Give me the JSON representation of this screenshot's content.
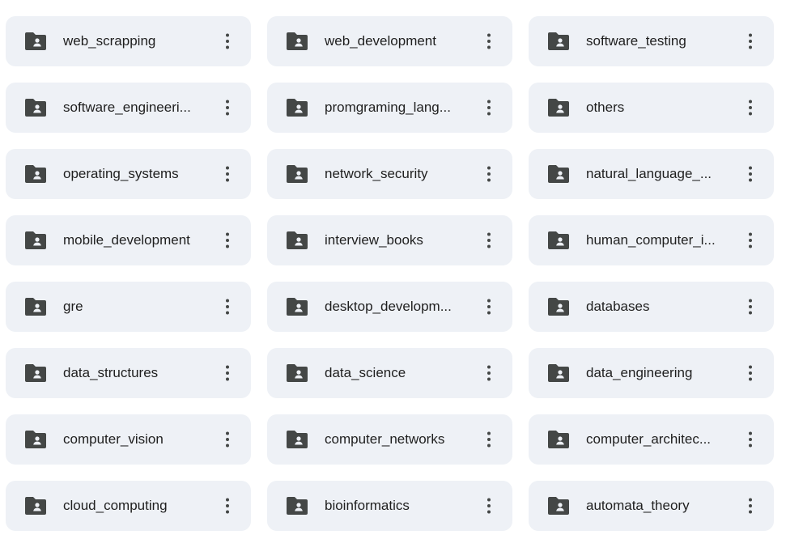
{
  "folders": [
    {
      "name": "web_scrapping"
    },
    {
      "name": "web_development"
    },
    {
      "name": "software_testing"
    },
    {
      "name": "software_engineeri..."
    },
    {
      "name": "promgraming_lang..."
    },
    {
      "name": "others"
    },
    {
      "name": "operating_systems"
    },
    {
      "name": "network_security"
    },
    {
      "name": "natural_language_..."
    },
    {
      "name": "mobile_development"
    },
    {
      "name": "interview_books"
    },
    {
      "name": "human_computer_i..."
    },
    {
      "name": "gre"
    },
    {
      "name": "desktop_developm..."
    },
    {
      "name": "databases"
    },
    {
      "name": "data_structures"
    },
    {
      "name": "data_science"
    },
    {
      "name": "data_engineering"
    },
    {
      "name": "computer_vision"
    },
    {
      "name": "computer_networks"
    },
    {
      "name": "computer_architec..."
    },
    {
      "name": "cloud_computing"
    },
    {
      "name": "bioinformatics"
    },
    {
      "name": "automata_theory"
    }
  ],
  "icons": {
    "folder": "shared-folder-icon",
    "more": "more-vert-icon"
  },
  "colors": {
    "card_background": "#eef1f6",
    "icon": "#444746",
    "text": "#1f1f1f"
  }
}
